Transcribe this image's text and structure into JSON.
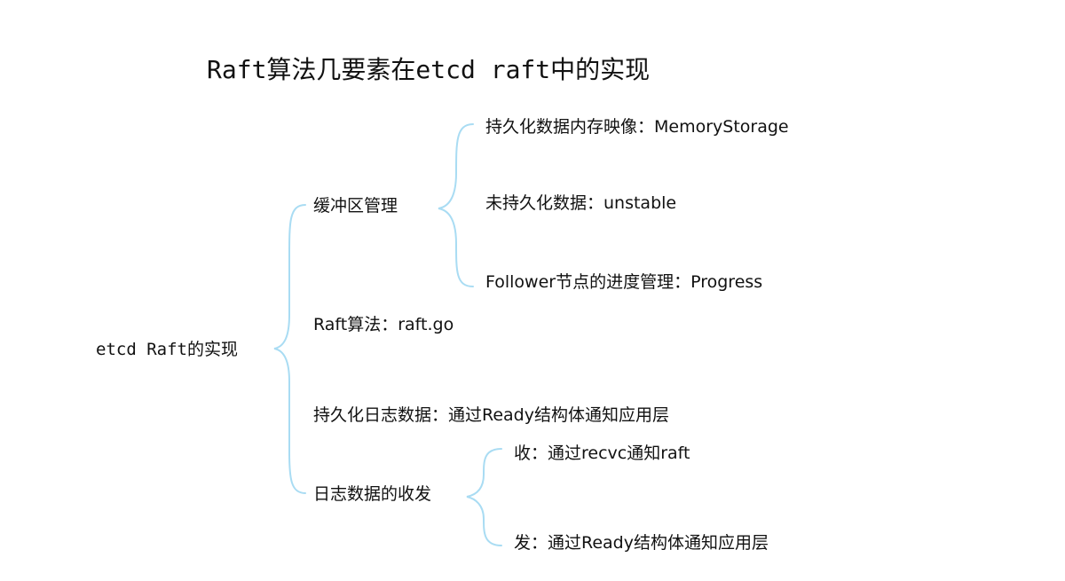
{
  "title": "Raft算法几要素在etcd raft中的实现",
  "root": {
    "label": "etcd Raft的实现"
  },
  "branches": [
    {
      "label": "缓冲区管理",
      "children": [
        {
          "label": "持久化数据内存映像：MemoryStorage"
        },
        {
          "label": "未持久化数据：unstable"
        },
        {
          "label": "Follower节点的进度管理：Progress"
        }
      ]
    },
    {
      "label": "Raft算法：raft.go"
    },
    {
      "label": "持久化日志数据：通过Ready结构体通知应用层"
    },
    {
      "label": "日志数据的收发",
      "children": [
        {
          "label": "收：通过recvc通知raft"
        },
        {
          "label": "发：通过Ready结构体通知应用层"
        }
      ]
    }
  ],
  "colors": {
    "connector": "#a9dcf3",
    "text": "#111111",
    "background": "#ffffff"
  }
}
